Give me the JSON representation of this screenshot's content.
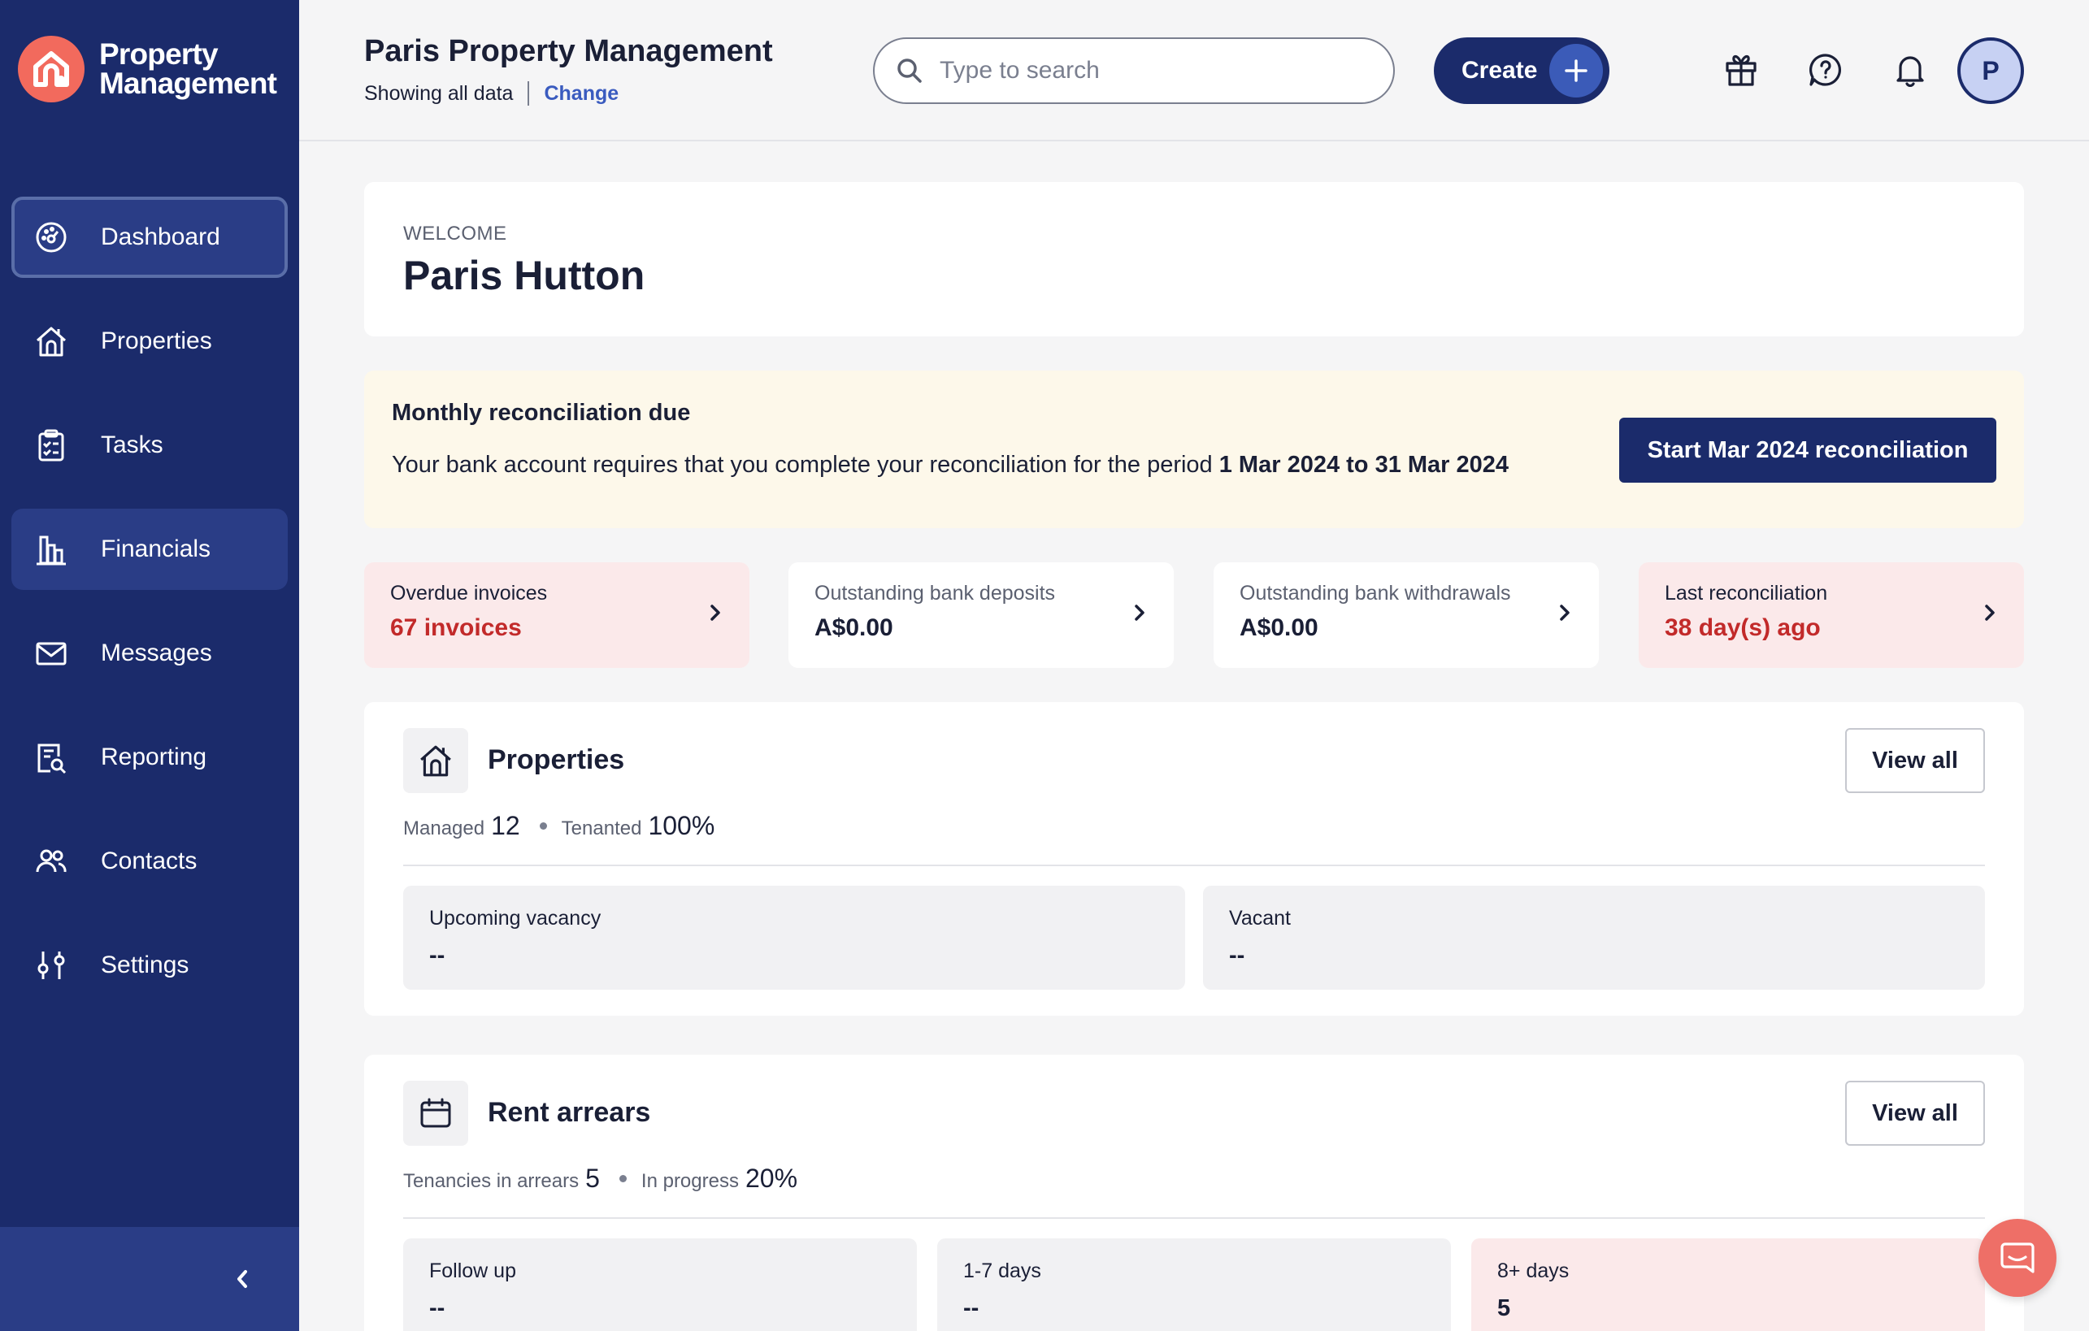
{
  "brand": {
    "line1": "Property",
    "line2": "Management"
  },
  "sidebar": {
    "items": [
      {
        "label": "Dashboard",
        "icon": "dashboard-icon"
      },
      {
        "label": "Properties",
        "icon": "house-icon"
      },
      {
        "label": "Tasks",
        "icon": "clipboard-icon"
      },
      {
        "label": "Financials",
        "icon": "bar-chart-icon"
      },
      {
        "label": "Messages",
        "icon": "envelope-icon"
      },
      {
        "label": "Reporting",
        "icon": "report-icon"
      },
      {
        "label": "Contacts",
        "icon": "people-icon"
      },
      {
        "label": "Settings",
        "icon": "sliders-icon"
      }
    ],
    "collapse_icon": "chevron-left-icon"
  },
  "header": {
    "org_name": "Paris Property Management",
    "scope_text": "Showing all data",
    "change_label": "Change",
    "search_placeholder": "Type to search",
    "create_label": "Create",
    "avatar_initial": "P"
  },
  "welcome": {
    "label": "WELCOME",
    "name": "Paris Hutton"
  },
  "reconciliation": {
    "title": "Monthly reconciliation due",
    "desc_prefix": "Your bank account requires that you complete your reconciliation for the period ",
    "period": "1 Mar 2024 to 31 Mar 2024",
    "button_label": "Start Mar 2024 reconciliation"
  },
  "stats": [
    {
      "label": "Overdue invoices",
      "value": "67 invoices",
      "alert": true
    },
    {
      "label": "Outstanding bank deposits",
      "value": "A$0.00",
      "alert": false
    },
    {
      "label": "Outstanding bank withdrawals",
      "value": "A$0.00",
      "alert": false
    },
    {
      "label": "Last reconciliation",
      "value": "38 day(s) ago",
      "alert": true
    }
  ],
  "properties": {
    "title": "Properties",
    "view_all": "View all",
    "managed_label": "Managed",
    "managed_value": "12",
    "tenanted_label": "Tenanted",
    "tenanted_value": "100%",
    "tiles": [
      {
        "label": "Upcoming vacancy",
        "value": "--"
      },
      {
        "label": "Vacant",
        "value": "--"
      }
    ]
  },
  "arrears": {
    "title": "Rent arrears",
    "view_all": "View all",
    "tenancies_label": "Tenancies in arrears",
    "tenancies_value": "5",
    "progress_label": "In progress",
    "progress_value": "20%",
    "tiles": [
      {
        "label": "Follow up",
        "value": "--"
      },
      {
        "label": "1-7 days",
        "value": "--"
      },
      {
        "label": "8+ days",
        "value": "5"
      }
    ]
  },
  "colors": {
    "sidebar": "#1b2b6b",
    "accent": "#1b2b6b",
    "brand_coral": "#f26a5d",
    "alert_bg": "#fbe9ea",
    "alert_text": "#c22a2a",
    "notice_bg": "#fdf8ea"
  }
}
